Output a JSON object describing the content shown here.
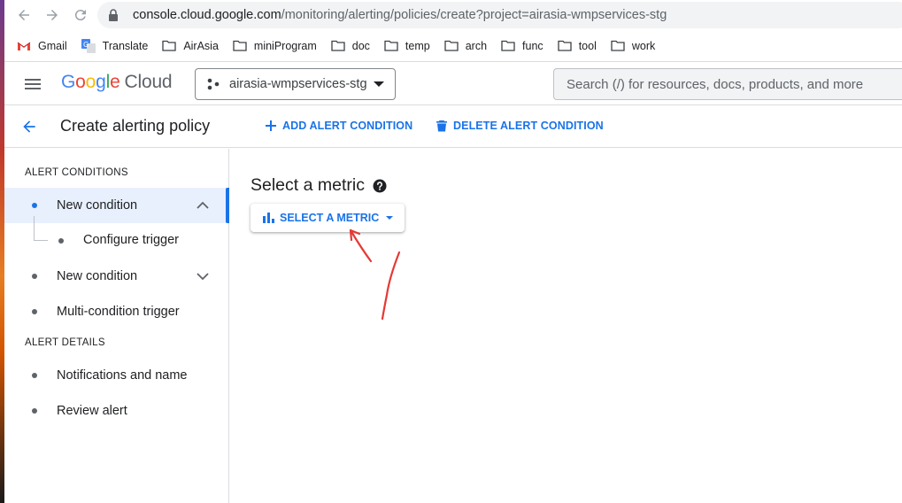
{
  "browser": {
    "url_host": "console.cloud.google.com",
    "url_path": "/monitoring/alerting/policies/create?project=airasia-wmpservices-stg",
    "bookmarks": [
      "Gmail",
      "Translate",
      "AirAsia",
      "miniProgram",
      "doc",
      "temp",
      "arch",
      "func",
      "tool",
      "work"
    ]
  },
  "header": {
    "logo_google": [
      "G",
      "o",
      "o",
      "g",
      "l",
      "e"
    ],
    "logo_cloud": "Cloud",
    "project": "airasia-wmpservices-stg",
    "search_placeholder": "Search (/) for resources, docs, products, and more"
  },
  "toolbar": {
    "title": "Create alerting policy",
    "add_condition": "ADD ALERT CONDITION",
    "delete_condition": "DELETE ALERT CONDITION"
  },
  "sidebar": {
    "alert_conditions_heading": "ALERT CONDITIONS",
    "items": [
      {
        "label": "New condition"
      },
      {
        "label": "Configure trigger"
      },
      {
        "label": "New condition"
      },
      {
        "label": "Multi-condition trigger"
      }
    ],
    "alert_details_heading": "ALERT DETAILS",
    "details": [
      {
        "label": "Notifications and name"
      },
      {
        "label": "Review alert"
      }
    ]
  },
  "main": {
    "section_title": "Select a metric",
    "select_metric_button": "SELECT A METRIC"
  },
  "colors": {
    "accent": "#1a73e8",
    "annotation": "#e53935"
  }
}
